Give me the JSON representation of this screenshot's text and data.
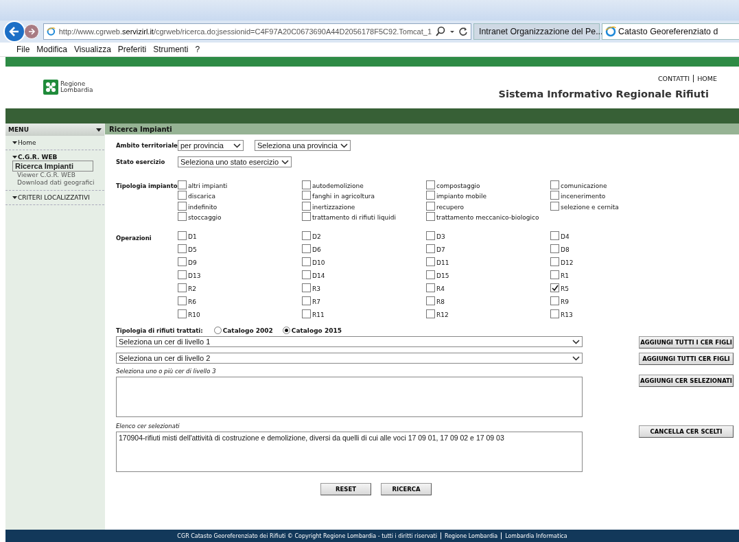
{
  "browser": {
    "address": "http://www.cgrweb.**servizirl.it**/cgrweb/ricerca.do;jsessionid=C4F97A20C0673690A44D2056178F5C92.Tomcat_1",
    "tabs": [
      {
        "title": "Intranet Organizzazione del Pe...",
        "selected": false
      },
      {
        "title": "Catasto Georeferenziato d",
        "selected": true
      }
    ],
    "menu": [
      "File",
      "Modifica",
      "Visualizza",
      "Preferiti",
      "Strumenti",
      "?"
    ]
  },
  "header": {
    "logo_lines": [
      "Regione",
      "Lombardia"
    ],
    "links": [
      "CONTATTI",
      "HOME"
    ],
    "title": "Sistema Informativo Regionale Rifiuti"
  },
  "sidebar": {
    "title": "MENU",
    "items": [
      {
        "label": "Home"
      },
      {
        "label": "C.G.R. WEB",
        "children": [
          {
            "label": "Ricerca Impianti",
            "selected": true
          },
          {
            "label": "Viewer C.G.R. WEB",
            "selected": false
          },
          {
            "label": "Download dati geografici",
            "selected": false
          }
        ]
      },
      {
        "label": "CRITERI LOCALIZZATIVI"
      }
    ]
  },
  "section_title": "Ricerca Impianti",
  "ambito": {
    "label": "Ambito territoriale",
    "selects": [
      "per provincia",
      "Seleziona una provincia"
    ]
  },
  "stato": {
    "label": "Stato esercizio",
    "select": "Seleziona uno stato esercizio"
  },
  "tipologia": {
    "label": "Tipologia impianto",
    "options": [
      {
        "label": "altri impianti",
        "checked": false
      },
      {
        "label": "autodemolizione",
        "checked": false
      },
      {
        "label": "compostaggio",
        "checked": false
      },
      {
        "label": "comunicazione",
        "checked": false
      },
      {
        "label": "discarica",
        "checked": false
      },
      {
        "label": "fanghi in agricoltura",
        "checked": false
      },
      {
        "label": "impianto mobile",
        "checked": false
      },
      {
        "label": "incenerimento",
        "checked": false
      },
      {
        "label": "indefinito",
        "checked": false
      },
      {
        "label": "inertizzazione",
        "checked": false
      },
      {
        "label": "recupero",
        "checked": false
      },
      {
        "label": "selezione e cernita",
        "checked": false
      },
      {
        "label": "stoccaggio",
        "checked": false
      },
      {
        "label": "trattamento di rifiuti liquidi",
        "checked": false
      },
      {
        "label": "trattamento meccanico-biologico",
        "checked": false
      }
    ]
  },
  "operazioni": {
    "label": "Operazioni",
    "options": [
      {
        "label": "D1",
        "checked": false
      },
      {
        "label": "D2",
        "checked": false
      },
      {
        "label": "D3",
        "checked": false
      },
      {
        "label": "D4",
        "checked": false
      },
      {
        "label": "D5",
        "checked": false
      },
      {
        "label": "D6",
        "checked": false
      },
      {
        "label": "D7",
        "checked": false
      },
      {
        "label": "D8",
        "checked": false
      },
      {
        "label": "D9",
        "checked": false
      },
      {
        "label": "D10",
        "checked": false
      },
      {
        "label": "D11",
        "checked": false
      },
      {
        "label": "D12",
        "checked": false
      },
      {
        "label": "D13",
        "checked": false
      },
      {
        "label": "D14",
        "checked": false
      },
      {
        "label": "D15",
        "checked": false
      },
      {
        "label": "R1",
        "checked": false
      },
      {
        "label": "R2",
        "checked": false
      },
      {
        "label": "R3",
        "checked": false
      },
      {
        "label": "R4",
        "checked": false
      },
      {
        "label": "R5",
        "checked": true
      },
      {
        "label": "R6",
        "checked": false
      },
      {
        "label": "R7",
        "checked": false
      },
      {
        "label": "R8",
        "checked": false
      },
      {
        "label": "R9",
        "checked": false
      },
      {
        "label": "R10",
        "checked": false
      },
      {
        "label": "R11",
        "checked": false
      },
      {
        "label": "R12",
        "checked": false
      },
      {
        "label": "R13",
        "checked": false
      }
    ]
  },
  "rifiuti": {
    "label": "Tipologia di rifiuti trattati:",
    "radios": [
      {
        "label": "Catalogo 2002",
        "selected": false
      },
      {
        "label": "Catalogo 2015",
        "selected": true
      }
    ]
  },
  "cer": {
    "level1": "Seleziona un cer di livello 1",
    "level2": "Seleziona un cer di livello 2",
    "add_all_1": "AGGIUNGI TUTTI I CER FIGLI",
    "add_all_2": "AGGIUNGI  TUTTI  CER FIGLI",
    "level3_label": "Seleziona uno o più cer di livello 3",
    "add_selected": "AGGIUNGI CER SELEZIONATI",
    "chosen_label": "Elenco cer selezionati",
    "chosen": [
      "170904-rifiuti misti dell'attività di costruzione e demolizione, diversi da quelli di cui alle voci 17 09 01, 17 09 02 e 17 09 03"
    ],
    "clear": "CANCELLA CER SCELTI"
  },
  "buttons": [
    "RESET",
    "RICERCA"
  ],
  "footer": [
    "CGR Catasto Georeferenziato dei Rifiuti © Copyright Regione Lombardia - tutti i diritti riservati",
    "Regione Lombardia",
    "Lombardia Informatica"
  ]
}
